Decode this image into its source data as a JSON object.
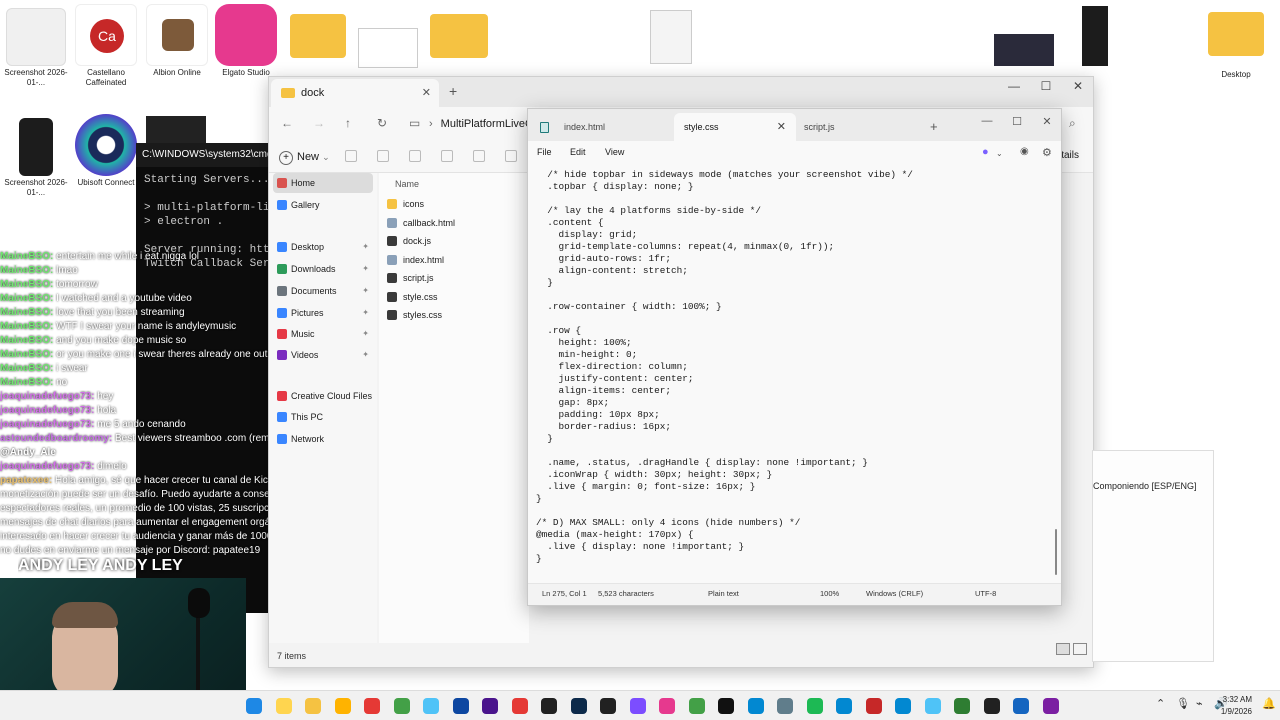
{
  "desktop_icons": [
    {
      "label": "Screenshot 2026-01-...",
      "color": "#eaeaea"
    },
    {
      "label": "Castellano Caffeinated",
      "color": "#c62828"
    },
    {
      "label": "Albion Online",
      "color": "#7d5a3a"
    },
    {
      "label": "Elgato Studio",
      "color": "#e6398e"
    },
    {
      "label": "Screenshot 2026-01-...",
      "color": "#1c1c1c"
    },
    {
      "label": "Ubisoft Connect",
      "color": "#1a2a5a"
    },
    {
      "label": "Desktop",
      "color": "#f5c242"
    }
  ],
  "cmd": {
    "title": "C:\\WINDOWS\\system32\\cmd.exe",
    "body": "Starting Servers...\n\n> multi-platform-live\n> electron .\n\nServer running: http:\nTwitch Callback Serve"
  },
  "chat": [
    {
      "user": "MaineBSO:",
      "text": "entertain me while i eat nigga lol",
      "color": "#6fe86f"
    },
    {
      "user": "MaineBSO:",
      "text": "lmao",
      "color": "#6fe86f"
    },
    {
      "user": "MaineBSO:",
      "text": "tomorrow",
      "color": "#6fe86f"
    },
    {
      "user": "MaineBSO:",
      "text": "I watched and a youtube video",
      "color": "#6fe86f"
    },
    {
      "user": "MaineBSO:",
      "text": "love that you been streaming",
      "color": "#6fe86f"
    },
    {
      "user": "MaineBSO:",
      "text": "WTF I swear your name is andyleymusic",
      "color": "#6fe86f"
    },
    {
      "user": "MaineBSO:",
      "text": "and you make dope music so",
      "color": "#6fe86f"
    },
    {
      "user": "MaineBSO:",
      "text": "or you make one i swear theres already one out there",
      "color": "#6fe86f"
    },
    {
      "user": "MaineBSO:",
      "text": "i swear",
      "color": "#6fe86f"
    },
    {
      "user": "MaineBSO:",
      "text": "no",
      "color": "#6fe86f"
    },
    {
      "user": "joaquinadefuego73:",
      "text": "hey",
      "color": "#d16fe8"
    },
    {
      "user": "joaquinadefuego73:",
      "text": "hola",
      "color": "#d16fe8"
    },
    {
      "user": "joaquinadefuego73:",
      "text": "me 5 ando cenando",
      "color": "#d16fe8"
    },
    {
      "user": "astoundedboardroomy:",
      "text": "Best viewers streamboo .com (remove the space)",
      "color": "#c86fe8"
    },
    {
      "user": "@Andy_Ale",
      "text": "",
      "color": "#ffffff"
    },
    {
      "user": "joaquinadefuego73:",
      "text": "dimelo",
      "color": "#d16fe8"
    },
    {
      "user": "papatexee:",
      "text": "Hola amigo, sé que hacer crecer tu canal de Kick y alcanzar la",
      "color": "#e8c06f"
    },
    {
      "user": "",
      "text": "monetización puede ser un desafío. Puedo ayudarte a conseguir 1,000",
      "color": "#ffffff"
    },
    {
      "user": "",
      "text": "espectadores reales, un promedio de 100 vistas, 25 suscripciones y 250",
      "color": "#ffffff"
    },
    {
      "user": "",
      "text": "mensajes de chat diarios para aumentar el engagement orgánico. Si estás",
      "color": "#ffffff"
    },
    {
      "user": "",
      "text": "interesado en hacer crecer tu audiencia y ganar más de 1000 mensualmente,",
      "color": "#ffffff"
    },
    {
      "user": "",
      "text": "no dudes en enviarme un mensaje por Discord: papatee19",
      "color": "#ffffff"
    }
  ],
  "banner": "ANDY LEY  ANDY LEY",
  "explorer": {
    "tab_title": "dock",
    "address": "MultiPlatformLiveC",
    "new_label": "New",
    "details_label": "Details",
    "sidebar": [
      {
        "label": "Home",
        "color": "#d9534f",
        "selected": true,
        "pin": false
      },
      {
        "label": "Gallery",
        "color": "#3a86ff",
        "selected": false,
        "pin": false
      },
      {
        "label": "Desktop",
        "color": "#3a86ff",
        "selected": false,
        "pin": true
      },
      {
        "label": "Downloads",
        "color": "#2d9b5a",
        "selected": false,
        "pin": true
      },
      {
        "label": "Documents",
        "color": "#6c757d",
        "selected": false,
        "pin": true
      },
      {
        "label": "Pictures",
        "color": "#3a86ff",
        "selected": false,
        "pin": true
      },
      {
        "label": "Music",
        "color": "#e63946",
        "selected": false,
        "pin": true
      },
      {
        "label": "Videos",
        "color": "#7b2cbf",
        "selected": false,
        "pin": true
      },
      {
        "label": "Creative Cloud Files",
        "color": "#e63946",
        "selected": false,
        "pin": false
      },
      {
        "label": "This PC",
        "color": "#3a86ff",
        "selected": false,
        "pin": false
      },
      {
        "label": "Network",
        "color": "#3a86ff",
        "selected": false,
        "pin": false
      }
    ],
    "column_name": "Name",
    "files": [
      {
        "name": "icons",
        "color": "#f5c242"
      },
      {
        "name": "callback.html",
        "color": "#8aa0b8"
      },
      {
        "name": "dock.js",
        "color": "#3a3a3a"
      },
      {
        "name": "index.html",
        "color": "#8aa0b8"
      },
      {
        "name": "script.js",
        "color": "#3a3a3a"
      },
      {
        "name": "style.css",
        "color": "#3a3a3a"
      },
      {
        "name": "styles.css",
        "color": "#3a3a3a"
      }
    ],
    "status": "7 items"
  },
  "notepad": {
    "tabs": [
      "index.html",
      "style.css",
      "script.js"
    ],
    "active_tab": 1,
    "menu": [
      "File",
      "Edit",
      "View"
    ],
    "code": "  /* hide topbar in sideways mode (matches your screenshot vibe) */\n  .topbar { display: none; }\n\n  /* lay the 4 platforms side-by-side */\n  .content {\n    display: grid;\n    grid-template-columns: repeat(4, minmax(0, 1fr));\n    grid-auto-rows: 1fr;\n    align-content: stretch;\n  }\n\n  .row-container { width: 100%; }\n\n  .row {\n    height: 100%;\n    min-height: 0;\n    flex-direction: column;\n    justify-content: center;\n    align-items: center;\n    gap: 8px;\n    padding: 10px 8px;\n    border-radius: 16px;\n  }\n\n  .name, .status, .dragHandle { display: none !important; }\n  .iconWrap { width: 30px; height: 30px; }\n  .live { margin: 0; font-size: 16px; }\n}\n\n/* D) MAX SMALL: only 4 icons (hide numbers) */\n@media (max-height: 170px) {\n  .live { display: none !important; }\n}",
    "status": {
      "position": "Ln 275, Col 1",
      "chars": "5,523 characters",
      "format": "Plain text",
      "zoom": "100%",
      "eol": "Windows (CRLF)",
      "encoding": "UTF-8"
    }
  },
  "behind_window_text": "Componiendo [ESP/ENG]",
  "taskbar": {
    "icons": [
      "file-explorer-icon",
      "paint-icon",
      "folder-icon",
      "notes-icon",
      "opera-icon",
      "xbox-icon",
      "snipping-icon",
      "photoshop-icon",
      "premiere-icon",
      "youtube-icon",
      "epic-icon",
      "steam-icon",
      "obs-icon",
      "discord-icon",
      "elgato-icon",
      "chrome-icon",
      "tiktok-icon",
      "edge-icon",
      "calculator-icon",
      "spotify-icon",
      "edge2-icon",
      "castellano-icon",
      "edge3-icon",
      "photos-icon",
      "notepad-icon",
      "terminal-icon",
      "vscode-icon",
      "snip-icon"
    ],
    "icon_colors": [
      "#1e88e5",
      "#ffd54f",
      "#f5c242",
      "#ffb300",
      "#e53935",
      "#43a047",
      "#4fc3f7",
      "#0d47a1",
      "#4a148c",
      "#e53935",
      "#212121",
      "#0d2a4a",
      "#212121",
      "#7c4dff",
      "#e6398e",
      "#43a047",
      "#111111",
      "#0288d1",
      "#607d8b",
      "#1db954",
      "#0288d1",
      "#c62828",
      "#0288d1",
      "#4fc3f7",
      "#2e7d32",
      "#212121",
      "#1565c0",
      "#7b1fa2"
    ],
    "time": "3:32 AM",
    "date": "1/9/2026"
  }
}
